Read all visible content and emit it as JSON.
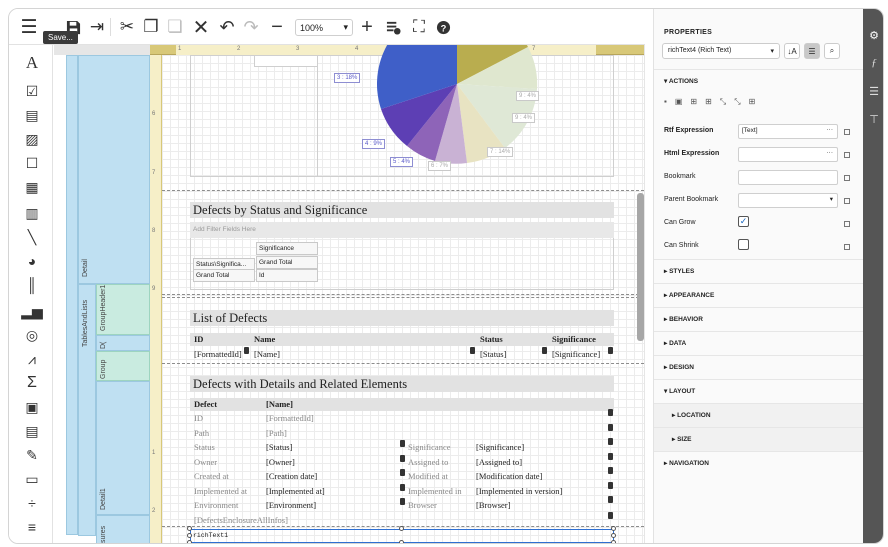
{
  "toolbar": {
    "tooltip": "Save...",
    "zoom": "100%",
    "icons": [
      "menu-icon",
      "save-icon",
      "exit-icon",
      "cut-icon",
      "copy-icon",
      "paste-icon",
      "delete-icon",
      "undo-icon",
      "redo-icon",
      "zoom-out-icon",
      "zoom-in-icon",
      "data-source-icon",
      "fullscreen-icon",
      "help-icon"
    ]
  },
  "left_tools": [
    "text-tool-icon",
    "checkbox-tool-icon",
    "richtext-tool-icon",
    "picture-tool-icon",
    "panel-tool-icon",
    "table-tool-icon",
    "charactercomb-tool-icon",
    "line-tool-icon",
    "shape-tool-icon",
    "barcode-tool-icon",
    "chart-tool-icon",
    "gauge-tool-icon",
    "sparkline-tool-icon",
    "summary-tool-icon",
    "page-info-tool-icon",
    "table-of-contents-tool-icon",
    "pdf-signature-tool-icon",
    "pivot-grid-tool-icon",
    "page-break-tool-icon",
    "cross-band-tool-icon"
  ],
  "ruler": {
    "h": [
      "1",
      "2",
      "3",
      "4",
      "5",
      "6",
      "7"
    ],
    "v": [
      "6",
      "7",
      "8",
      "9",
      "1",
      "2"
    ]
  },
  "bands": {
    "detail": "Detail",
    "tables": "TablesAndLists",
    "group_header": "GroupHeader1",
    "d": "D(",
    "group": "Group",
    "detail1": "Detail1",
    "sures": "sures"
  },
  "pie_labels": [
    "3 : 18%",
    "4 : 9%",
    "5 : 4%",
    "6 : 7%",
    "7 : 14%",
    "9 : 4%",
    "9 : 4%"
  ],
  "section1": {
    "title": "Defects by Status and Significance",
    "filter": "Add Filter Fields Here",
    "significance": "Significance",
    "row_header": "Status\\Significa...",
    "grand_total": "Grand Total",
    "grand_total2": "Grand Total",
    "id": "Id"
  },
  "section2": {
    "title": "List of Defects",
    "headers": [
      "ID",
      "Name",
      "Status",
      "Significance"
    ],
    "values": [
      "[FormattedId]",
      "[Name]",
      "[Status]",
      "[Significance]"
    ]
  },
  "section3": {
    "title": "Defects with Details and Related Elements",
    "header": [
      "Defect",
      "[Name]"
    ],
    "rows": [
      [
        "ID",
        "[FormattedId]",
        "",
        ""
      ],
      [
        "Path",
        "[Path]",
        "",
        ""
      ],
      [
        "Status",
        "[Status]",
        "Significance",
        "[Significance]"
      ],
      [
        "Owner",
        "[Owner]",
        "Assigned to",
        "[Assigned to]"
      ],
      [
        "Created at",
        "[Creation date]",
        "Modified at",
        "[Modification date]"
      ],
      [
        "Implemented at",
        "[Implemented at]",
        "Implemented in",
        "[Implemented in version]"
      ],
      [
        "Environment",
        "[Environment]",
        "Browser",
        "[Browser]"
      ]
    ],
    "enclosure": "[DefectsEnclosureAllInfos]",
    "richtext": "richText1"
  },
  "properties": {
    "title": "PROPERTIES",
    "selected": "richText4 (Rich Text)",
    "actions": "▾ ACTIONS",
    "rows": [
      {
        "label": "Rtf Expression",
        "value": "[Text]",
        "bold": true
      },
      {
        "label": "Html Expression",
        "value": "",
        "bold": true
      },
      {
        "label": "Bookmark",
        "value": ""
      },
      {
        "label": "Parent Bookmark",
        "value": ""
      },
      {
        "label": "Can Grow",
        "value": "✓"
      },
      {
        "label": "Can Shrink",
        "value": ""
      }
    ],
    "groups": [
      "▸ STYLES",
      "▸ APPEARANCE",
      "▸ BEHAVIOR",
      "▸ DATA",
      "▸ DESIGN",
      "▾ LAYOUT",
      "▸ LOCATION",
      "▸ SIZE",
      "▸ NAVIGATION"
    ]
  },
  "rightbar": [
    "settings-icon",
    "function-icon",
    "database-icon",
    "hierarchy-icon"
  ]
}
